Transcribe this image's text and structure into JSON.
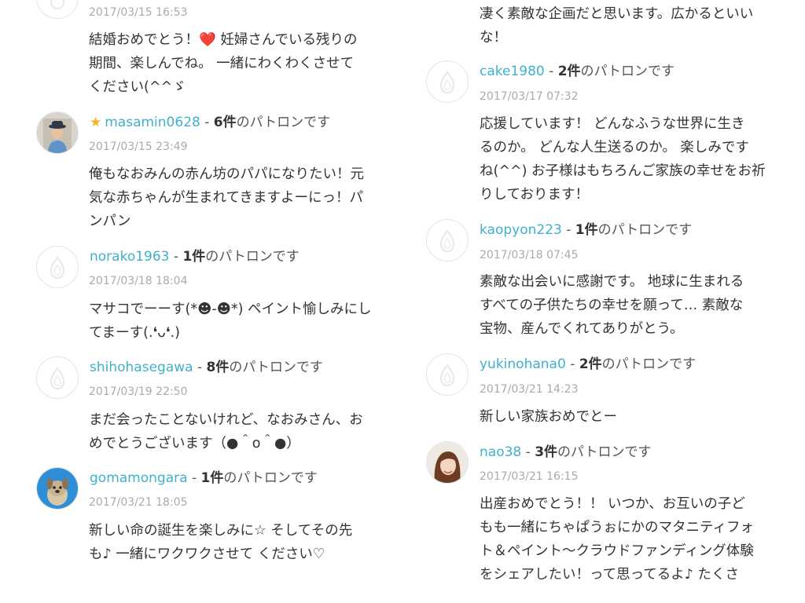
{
  "patron_suffix_count_unit": "件",
  "patron_suffix_text": "のパトロンです",
  "left": {
    "top_partial": {
      "date": "2017/03/15 16:53",
      "lines": [
        "結婚おめでとう！❤️ 妊婦さんでいる残りの",
        "期間、楽しんでね。 一緒にわくわくさせて",
        "ください(^^ゞ"
      ]
    },
    "comments": [
      {
        "username": "masamin0628",
        "count": "6",
        "date": "2017/03/15 23:49",
        "lines": [
          "俺もなおみんの赤ん坊のパパになりたい！元",
          "気な赤ちゃんが生まれてきますよーにっ！パ",
          "ンパン"
        ]
      },
      {
        "username": "norako1963",
        "count": "1",
        "date": "2017/03/18 18:04",
        "lines": [
          "マサコでーーす(*☻-☻*) ペイント愉しみにし",
          "てまーす(.❛ᴗ❛.)"
        ]
      },
      {
        "username": "shihohasegawa",
        "count": "8",
        "date": "2017/03/19 22:50",
        "lines": [
          "まだ会ったことないけれど、なおみさん、お",
          "めでとうございます（●＾o＾●）"
        ]
      },
      {
        "username": "gomamongara",
        "count": "1",
        "date": "2017/03/21 18:05",
        "lines": [
          "新しい命の誕生を楽しみに☆ そしてその先",
          "も♪ 一緒にワクワクさせて ください♡"
        ]
      }
    ]
  },
  "right": {
    "top_partial": {
      "lines": [
        "凄く素敵な企画だと思います。広かるといい",
        "な！"
      ]
    },
    "comments": [
      {
        "username": "cake1980",
        "count": "2",
        "date": "2017/03/17 07:32",
        "lines": [
          "応援しています！ どんなふうな世界に生き",
          "るのか。 どんな人生送るのか。 楽しみです",
          "ね(^^) お子様はもちろんご家族の幸せをお祈",
          "りしております！"
        ]
      },
      {
        "username": "kaopyon223",
        "count": "1",
        "date": "2017/03/18 07:45",
        "lines": [
          "素敵な出会いに感謝です。 地球に生まれる",
          "すべての子供たちの幸せを願って… 素敵な",
          "宝物、産んでくれてありがとう。"
        ]
      },
      {
        "username": "yukinohana0",
        "count": "2",
        "date": "2017/03/21 14:23",
        "lines": [
          "新しい家族おめでとー"
        ]
      },
      {
        "username": "nao38",
        "count": "3",
        "date": "2017/03/21 16:15",
        "lines": [
          "出産おめでとう！！ いつか、お互いの子ど",
          "もも一緒にちゃぱうぉにかのマタニティフォ",
          "ト＆ペイント〜クラウドファンディング体験",
          "をシェアしたい！って思ってるよ♪ たくさ"
        ]
      }
    ]
  },
  "colors": {
    "username": "#3fb1cc",
    "star": "#f3b61f",
    "date": "#aaaaaa",
    "body_text": "#333333"
  },
  "icons": {
    "default_avatar": "flame-logo-icon",
    "featured_star": "star-icon"
  }
}
